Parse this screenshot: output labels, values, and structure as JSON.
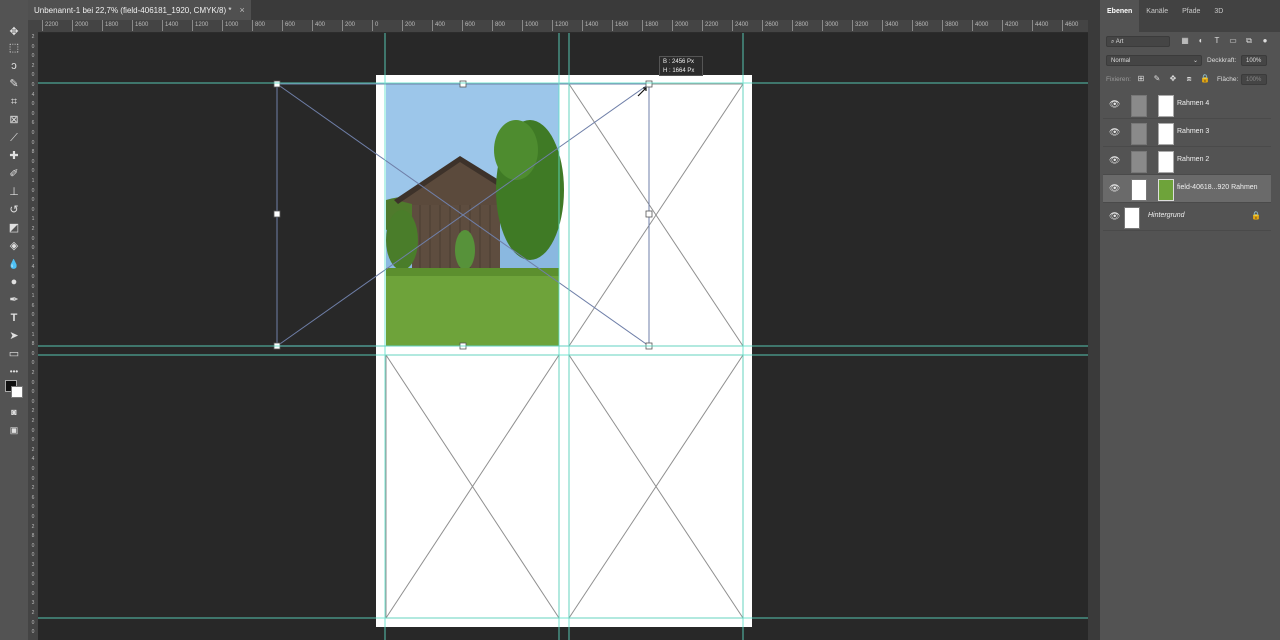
{
  "window": {
    "doc_tab_title": "Unbenannt-1 bei 22,7% (field-406181_1920, CMYK/8) *",
    "close_glyph": "×"
  },
  "tools": [
    {
      "icon": "move-icon",
      "glyph": "✥"
    },
    {
      "icon": "marquee-icon",
      "glyph": "⬚"
    },
    {
      "icon": "lasso-icon",
      "glyph": "ↄ"
    },
    {
      "icon": "quick-select-icon",
      "glyph": "✎"
    },
    {
      "icon": "crop-icon",
      "glyph": "⌗"
    },
    {
      "icon": "frame-tool-icon",
      "glyph": "⊠"
    },
    {
      "icon": "eyedropper-icon",
      "glyph": "⟋"
    },
    {
      "icon": "healing-icon",
      "glyph": "✚"
    },
    {
      "icon": "brush-icon",
      "glyph": "✐"
    },
    {
      "icon": "stamp-icon",
      "glyph": "⊥"
    },
    {
      "icon": "history-brush-icon",
      "glyph": "↺"
    },
    {
      "icon": "eraser-icon",
      "glyph": "◩"
    },
    {
      "icon": "gradient-icon",
      "glyph": "◈"
    },
    {
      "icon": "blur-icon",
      "glyph": "💧"
    },
    {
      "icon": "dodge-icon",
      "glyph": "●"
    },
    {
      "icon": "pen-icon",
      "glyph": "✒"
    },
    {
      "icon": "type-icon",
      "glyph": "T"
    },
    {
      "icon": "path-select-icon",
      "glyph": "➤"
    },
    {
      "icon": "shape-icon",
      "glyph": "▭"
    },
    {
      "icon": "hand-icon",
      "glyph": "✋"
    },
    {
      "icon": "more-tools-icon",
      "glyph": "•••"
    }
  ],
  "ruler_h": [
    "2200",
    "2000",
    "1800",
    "1600",
    "1400",
    "1200",
    "1000",
    "800",
    "600",
    "400",
    "200",
    "0",
    "200",
    "400",
    "600",
    "800",
    "1000",
    "1200",
    "1400",
    "1600",
    "1800",
    "2000",
    "2200",
    "2400",
    "2600",
    "2800",
    "3000",
    "3200",
    "3400",
    "3600",
    "3800",
    "4000",
    "4200",
    "4400",
    "4600"
  ],
  "ruler_v": [
    "2",
    "0",
    "0",
    "2",
    "0",
    "0",
    "4",
    "0",
    "0",
    "6",
    "0",
    "0",
    "8",
    "0",
    "0",
    "1",
    "0",
    "0",
    "0",
    "1",
    "2",
    "0",
    "0",
    "1",
    "4",
    "0",
    "0",
    "1",
    "6",
    "0",
    "0",
    "1",
    "8",
    "0",
    "0",
    "2",
    "0",
    "0",
    "0",
    "2",
    "2",
    "0",
    "0",
    "2",
    "4",
    "0",
    "0",
    "2",
    "6",
    "0",
    "0",
    "2",
    "8",
    "0",
    "0",
    "3",
    "0",
    "0",
    "0",
    "3",
    "2",
    "0",
    "0"
  ],
  "tooltip": {
    "width_label": "B :",
    "width_value": "2456 Px",
    "height_label": "H :",
    "height_value": "1664 Px"
  },
  "panel": {
    "tabs": [
      "Ebenen",
      "Kanäle",
      "Pfade",
      "3D"
    ],
    "filter_label": "Art",
    "blend_mode": "Normal",
    "opacity_label": "Deckkraft:",
    "opacity_value": "100%",
    "lock_label": "Fixieren:",
    "fill_label": "Fläche:",
    "fill_value": "100%",
    "layers": [
      {
        "name": "Rahmen 4",
        "selected": false
      },
      {
        "name": "Rahmen 3",
        "selected": false
      },
      {
        "name": "Rahmen 2",
        "selected": false
      },
      {
        "name": "field-40618...920 Rahmen",
        "selected": true
      },
      {
        "name": "Hintergrund",
        "selected": false
      }
    ]
  },
  "colors": {
    "guide": "#5fe0c8",
    "canvas_bg": "#282828",
    "panel_bg": "#535353",
    "frame_line": "#8a8a8a",
    "selection_line": "#6f7fa8"
  }
}
